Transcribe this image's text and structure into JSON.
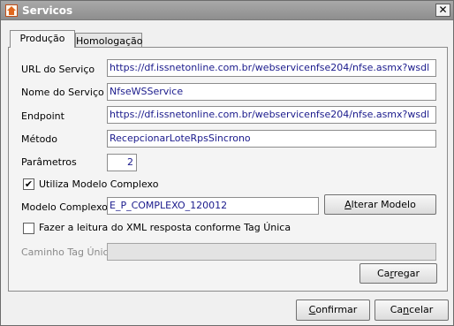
{
  "window": {
    "title": "Servicos",
    "close_glyph": "✕"
  },
  "tabs": [
    {
      "label": "Produção",
      "active": true
    },
    {
      "label": "Homologação",
      "active": false
    }
  ],
  "fields": {
    "url_label": "URL do Serviço",
    "url_value": "https://df.issnetonline.com.br/webservicenfse204/nfse.asmx?wsdl",
    "name_label": "Nome do Serviço",
    "name_value": "NfseWSService",
    "endpoint_label": "Endpoint",
    "endpoint_value": "https://df.issnetonline.com.br/webservicenfse204/nfse.asmx?wsdl",
    "method_label": "Método",
    "method_value": "RecepcionarLoteRpsSincrono",
    "params_label": "Parâmetros",
    "params_value": "2"
  },
  "complex_model": {
    "checkbox_label": "Utiliza Modelo Complexo",
    "checked": true,
    "model_label": "Modelo Complexo",
    "model_value": "E_P_COMPLEXO_120012",
    "change_button_pre": "",
    "change_button_mnemonic": "A",
    "change_button_post": "lterar Modelo"
  },
  "tag_unica": {
    "checkbox_label": "Fazer a leitura do XML resposta conforme Tag Única",
    "checked": false,
    "path_label": "Caminho Tag Única",
    "path_value": "",
    "load_button_pre": "Ca",
    "load_button_mnemonic": "r",
    "load_button_post": "regar"
  },
  "footer": {
    "confirm_pre": "",
    "confirm_mnemonic": "C",
    "confirm_post": "onfirmar",
    "cancel_pre": "Ca",
    "cancel_mnemonic": "n",
    "cancel_post": "celar"
  },
  "icons": {
    "app": "app-icon",
    "close": "close-icon",
    "check": "checkmark-icon"
  }
}
